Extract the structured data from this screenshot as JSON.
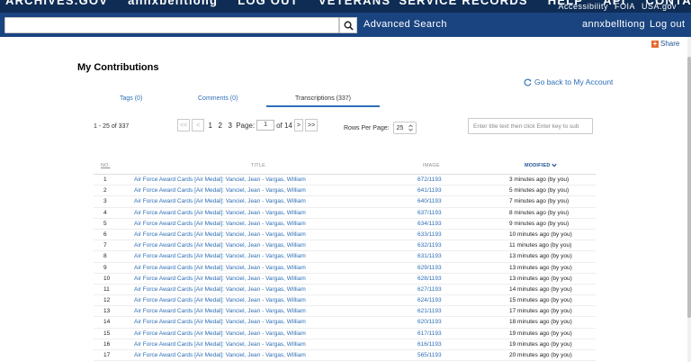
{
  "topnav": {
    "links": [
      "ARCHIVES.GOV",
      "annxbelltiong",
      "LOG OUT",
      "VETERANS' SERVICE RECORDS",
      "HELP",
      "API",
      "CONTACT US"
    ],
    "utility": [
      "Accessibility",
      "FOIA",
      "USA.gov"
    ]
  },
  "search": {
    "placeholder": "",
    "advanced_label": "Advanced Search",
    "username": "annxbelltiong",
    "logout_label": "Log out"
  },
  "share_label": "Share",
  "page_title": "My Contributions",
  "back_link": "Go back to My Account",
  "tabs": [
    {
      "label": "Tags (0)"
    },
    {
      "label": "Comments (0)"
    },
    {
      "label": "Transcriptions (337)"
    }
  ],
  "pagination": {
    "range_text": "1 - 25 of 337",
    "first": "<<",
    "prev": "<",
    "pages": [
      "1",
      "2",
      "3"
    ],
    "page_label": "Page:",
    "current_page": "1",
    "of_label": "of 14",
    "next": ">",
    "last": ">>"
  },
  "rows_per_page": {
    "label": "Rows Per Page:",
    "value": "25"
  },
  "filter": {
    "placeholder": "Enter title text then click Enter key to sub"
  },
  "table": {
    "headers": {
      "no": "NO.",
      "title": "TITLE",
      "image": "IMAGE",
      "modified": "MODIFIED"
    },
    "rows": [
      {
        "no": "1",
        "title": "Air Force Award Cards [Air Medal]: Vanciel, Jean - Vargas, William",
        "image": "672/1193",
        "modified": "3 minutes ago (by you)"
      },
      {
        "no": "2",
        "title": "Air Force Award Cards [Air Medal]: Vanciel, Jean - Vargas, William",
        "image": "641/1193",
        "modified": "5 minutes ago (by you)"
      },
      {
        "no": "3",
        "title": "Air Force Award Cards [Air Medal]: Vanciel, Jean - Vargas, William",
        "image": "640/1193",
        "modified": "7 minutes ago (by you)"
      },
      {
        "no": "4",
        "title": "Air Force Award Cards [Air Medal]: Vanciel, Jean - Vargas, William",
        "image": "637/1193",
        "modified": "8 minutes ago (by you)"
      },
      {
        "no": "5",
        "title": "Air Force Award Cards [Air Medal]: Vanciel, Jean - Vargas, William",
        "image": "634/1193",
        "modified": "9 minutes ago (by you)"
      },
      {
        "no": "6",
        "title": "Air Force Award Cards [Air Medal]: Vanciel, Jean - Vargas, William",
        "image": "633/1193",
        "modified": "10 minutes ago (by you)"
      },
      {
        "no": "7",
        "title": "Air Force Award Cards [Air Medal]: Vanciel, Jean - Vargas, William",
        "image": "632/1193",
        "modified": "11 minutes ago (by you)"
      },
      {
        "no": "8",
        "title": "Air Force Award Cards [Air Medal]: Vanciel, Jean - Vargas, William",
        "image": "631/1193",
        "modified": "13 minutes ago (by you)"
      },
      {
        "no": "9",
        "title": "Air Force Award Cards [Air Medal]: Vanciel, Jean - Vargas, William",
        "image": "629/1193",
        "modified": "13 minutes ago (by you)"
      },
      {
        "no": "10",
        "title": "Air Force Award Cards [Air Medal]: Vanciel, Jean - Vargas, William",
        "image": "628/1193",
        "modified": "13 minutes ago (by you)"
      },
      {
        "no": "11",
        "title": "Air Force Award Cards [Air Medal]: Vanciel, Jean - Vargas, William",
        "image": "627/1193",
        "modified": "14 minutes ago (by you)"
      },
      {
        "no": "12",
        "title": "Air Force Award Cards [Air Medal]: Vanciel, Jean - Vargas, William",
        "image": "624/1193",
        "modified": "15 minutes ago (by you)"
      },
      {
        "no": "13",
        "title": "Air Force Award Cards [Air Medal]: Vanciel, Jean - Vargas, William",
        "image": "621/1193",
        "modified": "17 minutes ago (by you)"
      },
      {
        "no": "14",
        "title": "Air Force Award Cards [Air Medal]: Vanciel, Jean - Vargas, William",
        "image": "620/1193",
        "modified": "18 minutes ago (by you)"
      },
      {
        "no": "15",
        "title": "Air Force Award Cards [Air Medal]: Vanciel, Jean - Vargas, William",
        "image": "617/1193",
        "modified": "19 minutes ago (by you)"
      },
      {
        "no": "16",
        "title": "Air Force Award Cards [Air Medal]: Vanciel, Jean - Vargas, William",
        "image": "616/1193",
        "modified": "19 minutes ago (by you)"
      },
      {
        "no": "17",
        "title": "Air Force Award Cards [Air Medal]: Vanciel, Jean - Vargas, William",
        "image": "565/1193",
        "modified": "20 minutes ago (by you)"
      }
    ]
  },
  "colors": {
    "nav_dark": "#0e2c54",
    "nav_blue": "#1a4480",
    "link": "#2e6fb5",
    "share_orange": "#e56a2f"
  }
}
